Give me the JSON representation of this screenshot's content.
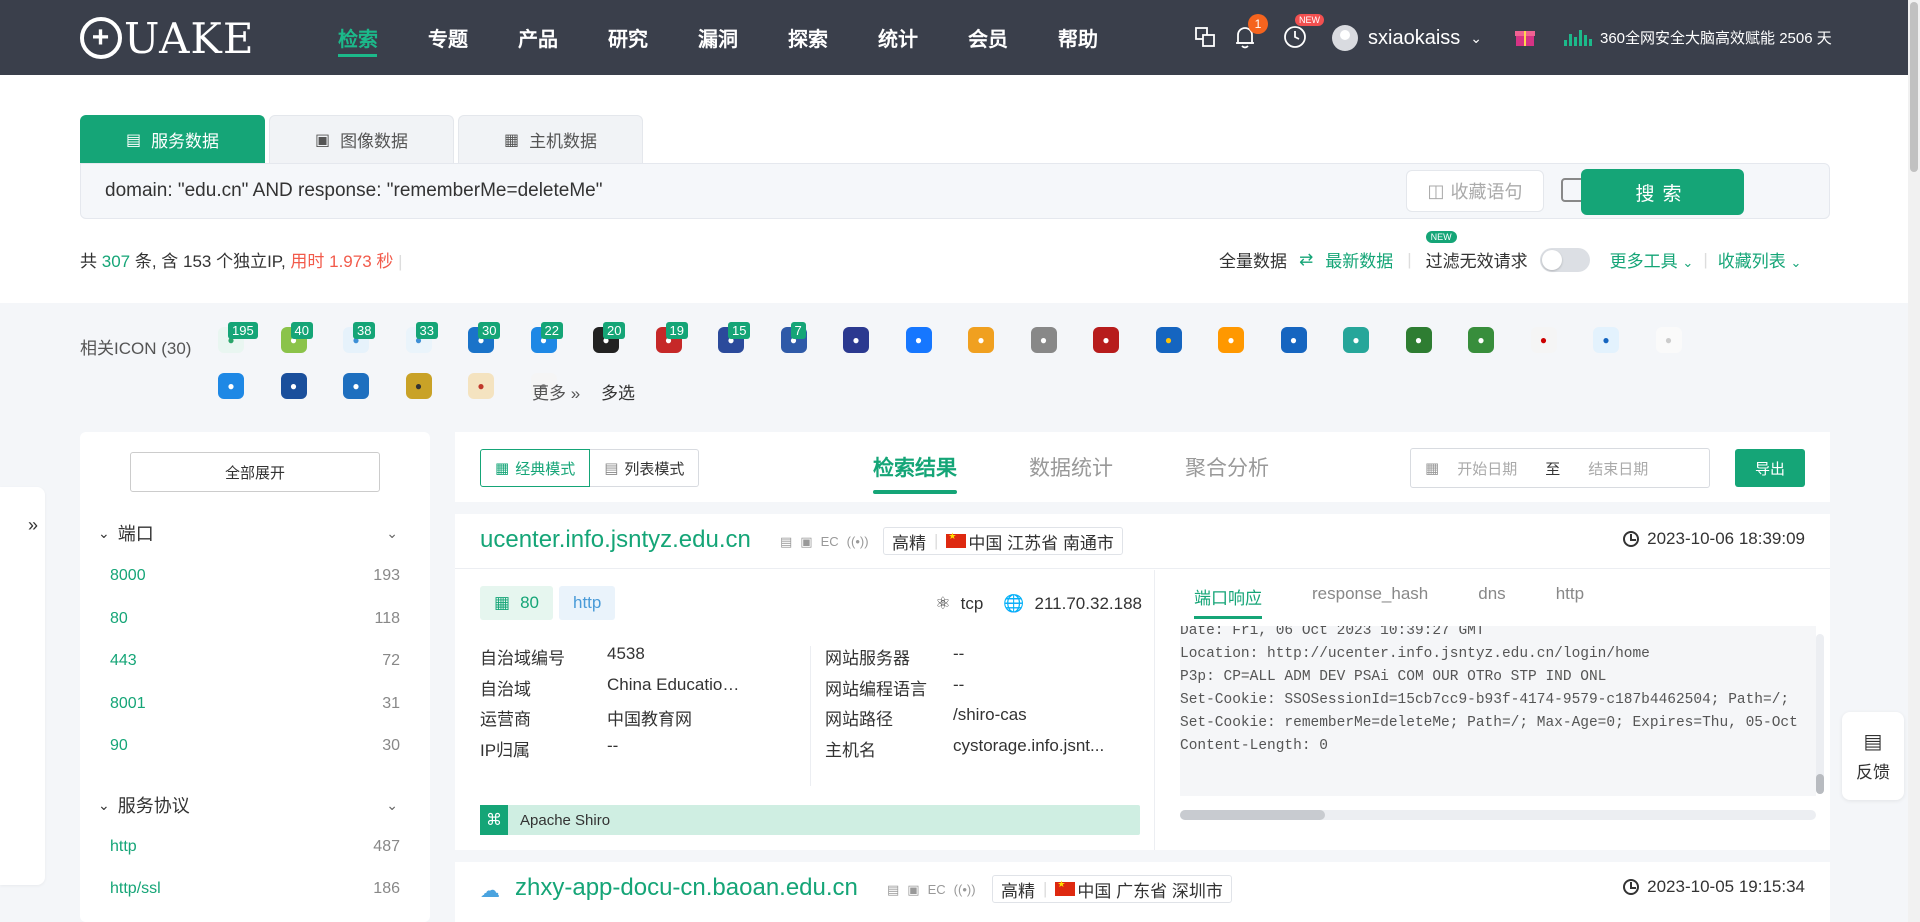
{
  "nav": {
    "logo": "QUAKE",
    "items": [
      "检索",
      "专题",
      "产品",
      "研究",
      "漏洞",
      "探索",
      "统计",
      "会员",
      "帮助"
    ],
    "notification_count": "1",
    "new_tag": "NEW",
    "username": "sxiaokaiss",
    "promo_text": "360全网安全大脑高效赋能 2506 天"
  },
  "search": {
    "tabs": [
      "服务数据",
      "图像数据",
      "主机数据"
    ],
    "query": "domain: \"edu.cn\" AND response: \"rememberMe=deleteMe\"",
    "fav_label": "收藏语句",
    "button": "搜索"
  },
  "stats": {
    "prefix": "共 ",
    "total": "307",
    "mid": " 条, 含 153 个独立IP, ",
    "time": "用时 1.973 秒",
    "full_data": "全量数据",
    "latest_data": "最新数据",
    "new_tag": "NEW",
    "filter_invalid": "过滤无效请求",
    "more_tools": "更多工具",
    "fav_list": "收藏列表"
  },
  "icons": {
    "label": "相关ICON (30)",
    "more": "更多",
    "multi": "多选",
    "items": [
      {
        "count": "195",
        "color": "#e9f6f1",
        "fg": "#2aa56a",
        "name": "bolt-icon"
      },
      {
        "count": "40",
        "color": "#8bc34a",
        "fg": "#fff",
        "name": "leaf-icon"
      },
      {
        "count": "38",
        "color": "#e6f2fb",
        "fg": "#3d8fd6",
        "name": "cloud-icon"
      },
      {
        "count": "33",
        "color": "#eaf4fb",
        "fg": "#3d8fd6",
        "name": "water-icon"
      },
      {
        "count": "30",
        "color": "#1a73c9",
        "fg": "#fff",
        "name": "edu-icon"
      },
      {
        "count": "22",
        "color": "#1e88e5",
        "fg": "#fff",
        "name": "e-logo-icon"
      },
      {
        "count": "20",
        "color": "#222",
        "fg": "#fff",
        "name": "bird-icon"
      },
      {
        "count": "19",
        "color": "#c62828",
        "fg": "#fff",
        "name": "lion-icon"
      },
      {
        "count": "15",
        "color": "#2b4a9b",
        "fg": "#fff",
        "name": "globe-icon"
      },
      {
        "count": "7",
        "color": "#2f5aa8",
        "fg": "#fff",
        "name": "shield-icon"
      },
      {
        "count": "",
        "color": "#2b3990",
        "fg": "#fff",
        "name": "ball-icon"
      },
      {
        "count": "",
        "color": "#1677ff",
        "fg": "#fff",
        "name": "m-logo-icon"
      },
      {
        "count": "",
        "color": "#f0a020",
        "fg": "#fff",
        "name": "cube-icon"
      },
      {
        "count": "",
        "color": "#888",
        "fg": "#fff",
        "name": "swirl-icon"
      },
      {
        "count": "",
        "color": "#b71c1c",
        "fg": "#fff",
        "name": "r-logo-icon"
      },
      {
        "count": "",
        "color": "#1565c0",
        "fg": "#ffc107",
        "name": "stripes-icon"
      },
      {
        "count": "",
        "color": "#ff9800",
        "fg": "#fff",
        "name": "ring-icon"
      },
      {
        "count": "",
        "color": "#1565c0",
        "fg": "#fff",
        "name": "diamond-icon"
      },
      {
        "count": "",
        "color": "#26a69a",
        "fg": "#fff",
        "name": "link-icon"
      },
      {
        "count": "",
        "color": "#2e7d32",
        "fg": "#fff",
        "name": "seal-icon"
      },
      {
        "count": "",
        "color": "#388e3c",
        "fg": "#fff",
        "name": "badge-icon"
      },
      {
        "count": "",
        "color": "#f5f5f5",
        "fg": "#c00",
        "name": "cips-icon"
      },
      {
        "count": "",
        "color": "#e3f2fd",
        "fg": "#1565c0",
        "name": "emblem-icon"
      },
      {
        "count": "",
        "color": "#fafafa",
        "fg": "#ccc",
        "name": "blank-icon"
      },
      {
        "count": "",
        "color": "#1e88e5",
        "fg": "#fff",
        "name": "hex-icon"
      },
      {
        "count": "",
        "color": "#1a4f9c",
        "fg": "#fff",
        "name": "uni-seal-icon"
      },
      {
        "count": "",
        "color": "#1e6fbf",
        "fg": "#fff",
        "name": "round-seal-icon"
      },
      {
        "count": "",
        "color": "#c9a227",
        "fg": "#333",
        "name": "tiger-icon"
      },
      {
        "count": "",
        "color": "#f4e3c0",
        "fg": "#c0392b",
        "name": "figure-icon"
      },
      {
        "count": "",
        "color": "#f5f5f5",
        "fg": "#999",
        "name": "p-logo-icon"
      }
    ]
  },
  "filter": {
    "expand_all": "全部展开",
    "port_title": "端口",
    "ports": [
      {
        "k": "8000",
        "v": "193"
      },
      {
        "k": "80",
        "v": "118"
      },
      {
        "k": "443",
        "v": "72"
      },
      {
        "k": "8001",
        "v": "31"
      },
      {
        "k": "90",
        "v": "30"
      }
    ],
    "proto_title": "服务协议",
    "protos": [
      {
        "k": "http",
        "v": "487"
      },
      {
        "k": "http/ssl",
        "v": "186"
      }
    ]
  },
  "toolbar": {
    "classic_mode": "经典模式",
    "list_mode": "列表模式",
    "tabs": [
      "检索结果",
      "数据统计",
      "聚合分析"
    ],
    "start_date": "开始日期",
    "to": "至",
    "end_date": "结束日期",
    "export": "导出"
  },
  "results": [
    {
      "domain": "ucenter.info.jsntyz.edu.cn",
      "precise": "高精",
      "location": "中国 江苏省 南通市",
      "time": "2023-10-06 18:39:09",
      "port": "80",
      "protocol": "http",
      "transport": "tcp",
      "ip": "211.70.32.188",
      "fields": {
        "asn_label": "自治域编号",
        "asn": "4538",
        "as_label": "自治域",
        "as": "China Education a...",
        "isp_label": "运营商",
        "isp": "中国教育网",
        "ipgeo_label": "IP归属",
        "ipgeo": "--",
        "server_label": "网站服务器",
        "server": "--",
        "lang_label": "网站编程语言",
        "lang": "--",
        "path_label": "网站路径",
        "path": "/shiro-cas",
        "host_label": "主机名",
        "host": "cystorage.info.jsnt..."
      },
      "component": "Apache Shiro",
      "resp_tabs": [
        "端口响应",
        "response_hash",
        "dns",
        "http"
      ],
      "response": "Date: Fri, 06 Oct 2023 10:39:27 GMT\nLocation: http://ucenter.info.jsntyz.edu.cn/login/home\nP3p: CP=ALL ADM DEV PSAi COM OUR OTRo STP IND ONL\nSet-Cookie: SSOSessionId=15cb7cc9-b93f-4174-9579-c187b4462504; Path=/;\nSet-Cookie: rememberMe=deleteMe; Path=/; Max-Age=0; Expires=Thu, 05-Oct\nContent-Length: 0"
    },
    {
      "domain": "zhxy-app-docu-cn.baoan.edu.cn",
      "precise": "高精",
      "location": "中国 广东省 深圳市",
      "time": "2023-10-05 19:15:34"
    }
  ],
  "feedback": "反馈"
}
